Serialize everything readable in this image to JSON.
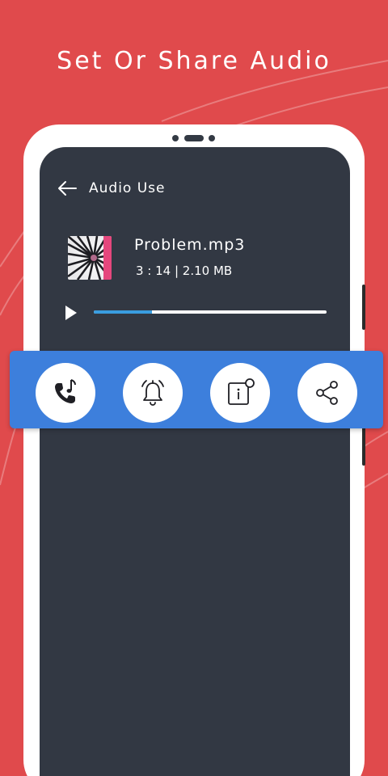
{
  "headline": "Set Or Share Audio",
  "header": {
    "title": "Audio Use",
    "back_icon": "back-arrow-icon"
  },
  "track": {
    "name": "Problem.mp3",
    "meta": "3 : 14 | 2.10 MB",
    "progress": 0.25
  },
  "actions": [
    {
      "id": "ringtone",
      "icon": "phone-ringtone-icon"
    },
    {
      "id": "alarm",
      "icon": "alarm-bell-icon"
    },
    {
      "id": "info",
      "icon": "info-icon"
    },
    {
      "id": "share",
      "icon": "share-icon"
    }
  ],
  "colors": {
    "background": "#e04a4c",
    "screen": "#323843",
    "action_bar": "#3d7fdc",
    "progress": "#3a9de0"
  }
}
